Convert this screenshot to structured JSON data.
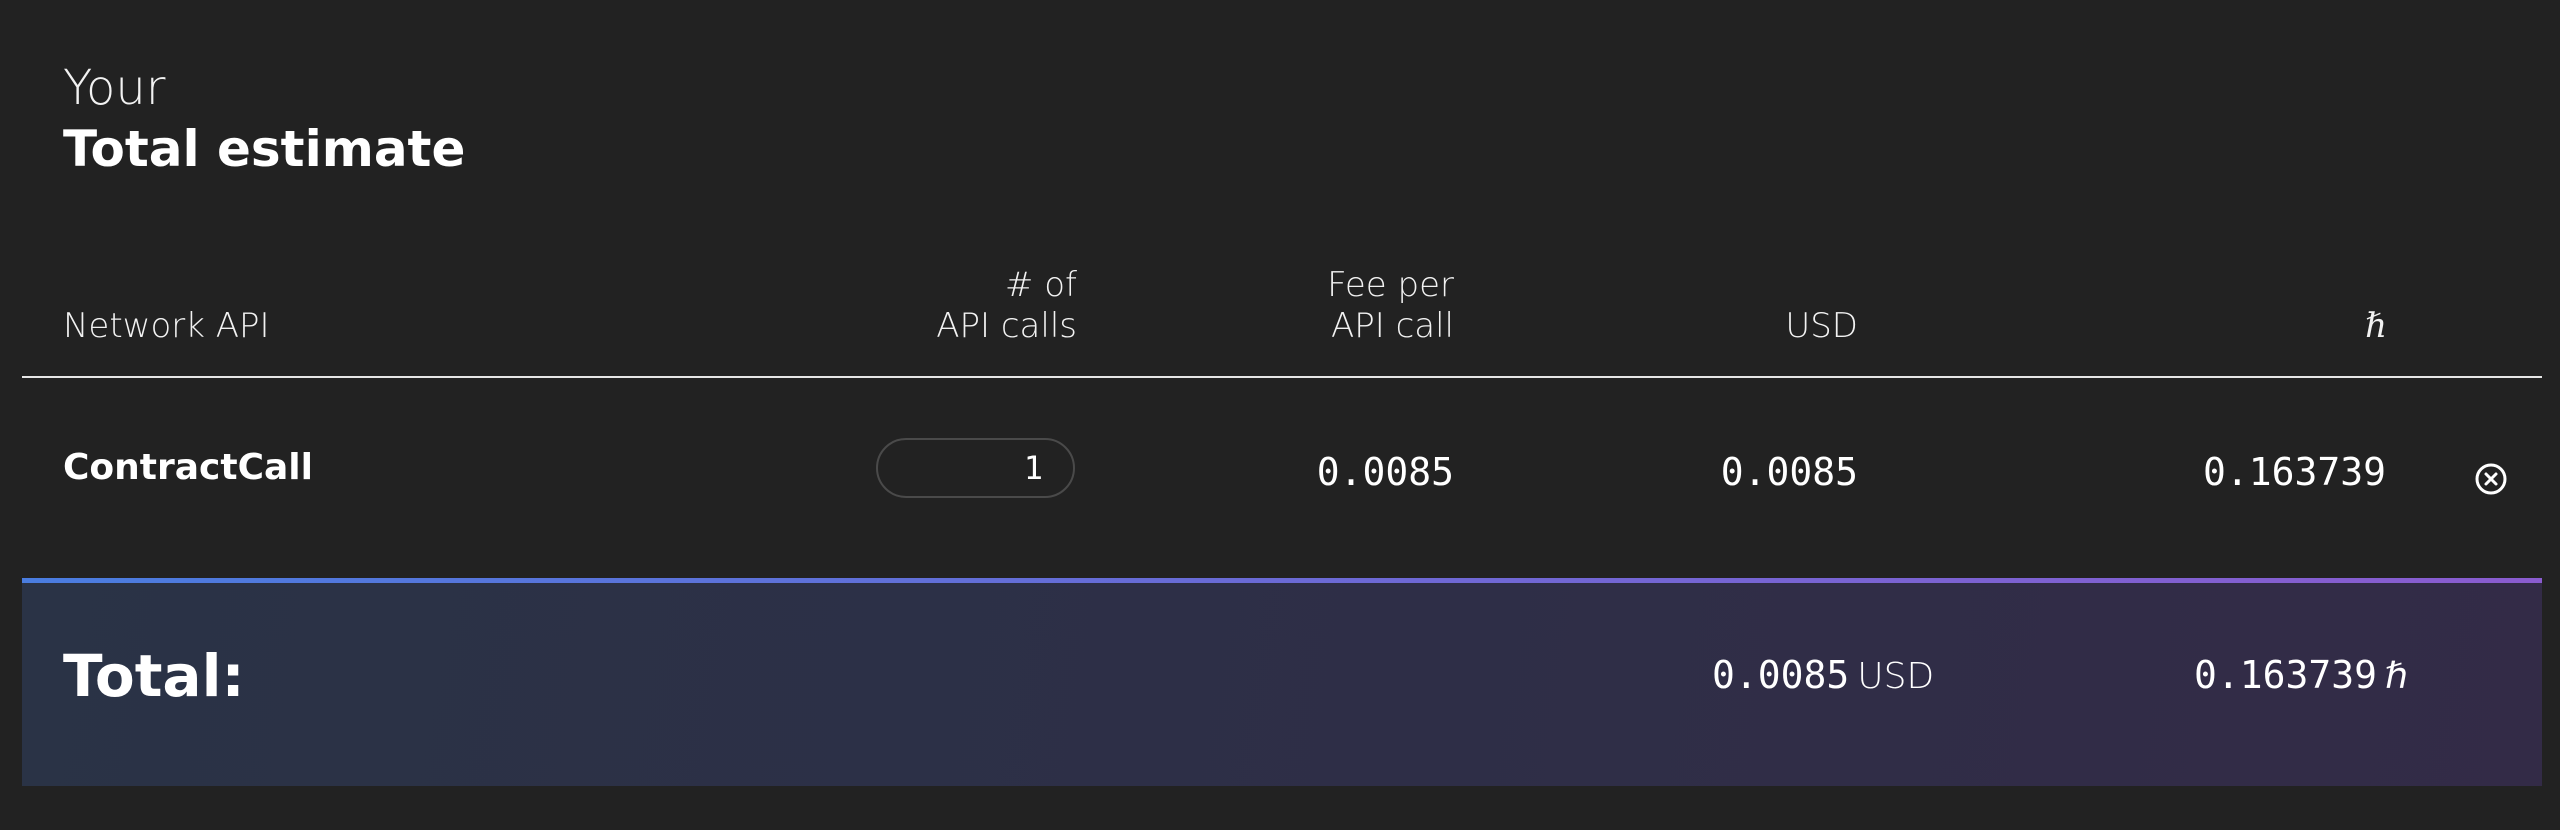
{
  "heading": {
    "line1": "Your",
    "line2": "Total estimate"
  },
  "table": {
    "headers": {
      "network_api": "Network API",
      "calls_line1": "# of",
      "calls_line2": "API calls",
      "fee_line1": "Fee per",
      "fee_line2": "API call",
      "usd": "USD",
      "hbar": "ℏ"
    },
    "rows": [
      {
        "name": "ContractCall",
        "calls": "1",
        "fee": "0.0085",
        "usd": "0.0085",
        "hbar": "0.163739"
      }
    ]
  },
  "total": {
    "label": "Total:",
    "usd_value": "0.0085",
    "usd_unit": "USD",
    "hbar_value": "0.163739",
    "hbar_unit": "ℏ"
  },
  "icons": {
    "remove_row": "close-circle-icon"
  },
  "colors": {
    "background": "#222222",
    "accent_start": "#4a7de0",
    "accent_end": "#8a5ccf"
  }
}
